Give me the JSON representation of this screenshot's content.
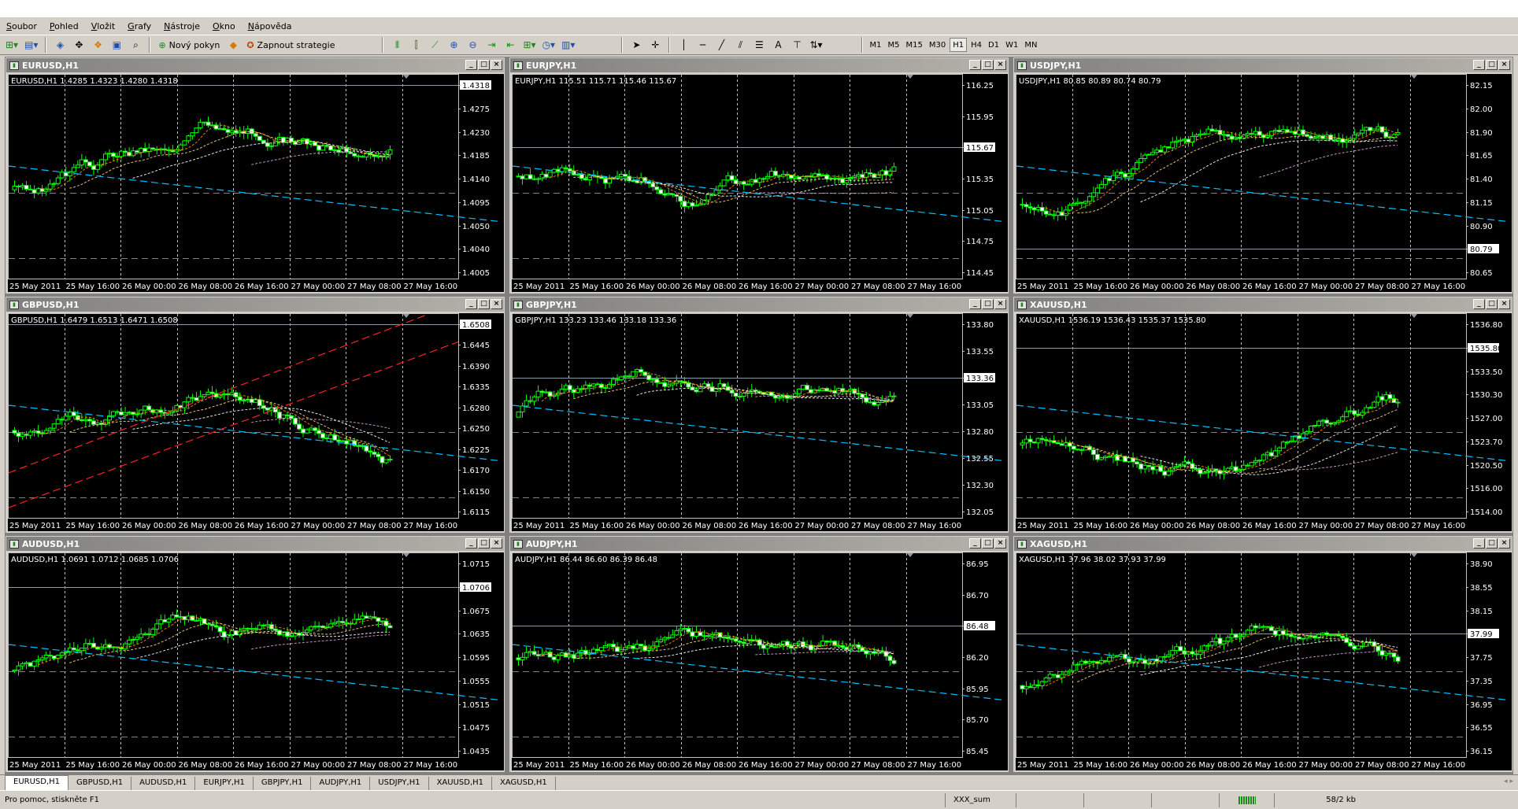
{
  "menu": [
    "Soubor",
    "Pohled",
    "Vložit",
    "Grafy",
    "Nástroje",
    "Okno",
    "Nápověda"
  ],
  "toolbar": {
    "new_order": "Nový pokyn",
    "strategies": "Zapnout strategie",
    "timeframes": [
      "M1",
      "M5",
      "M15",
      "M30",
      "H1",
      "H4",
      "D1",
      "W1",
      "MN"
    ],
    "active_timeframe": "H1"
  },
  "time_labels": [
    "25 May 2011",
    "25 May 16:00",
    "26 May 00:00",
    "26 May 08:00",
    "26 May 16:00",
    "27 May 00:00",
    "27 May 08:00",
    "27 May 16:00"
  ],
  "charts": [
    {
      "title": "EURUSD,H1",
      "ohlc_label": "EURUSD,H1  1.4285 1.4323 1.4280 1.4318",
      "ylabels": [
        "1.4318",
        "1.4275",
        "1.4230",
        "1.4185",
        "1.4140",
        "1.4095",
        "1.4050",
        "1.4040",
        "1.4005"
      ],
      "current": "1.4318"
    },
    {
      "title": "EURJPY,H1",
      "ohlc_label": "EURJPY,H1  115.51 115.71 115.46 115.67",
      "ylabels": [
        "116.25",
        "115.95",
        "115.67",
        "115.35",
        "115.05",
        "114.75",
        "114.45"
      ],
      "current": "115.67"
    },
    {
      "title": "USDJPY,H1",
      "ohlc_label": "USDJPY,H1  80.85 80.89 80.74 80.79",
      "ylabels": [
        "82.15",
        "82.00",
        "81.90",
        "81.65",
        "81.40",
        "81.15",
        "80.90",
        "80.79",
        "80.65"
      ],
      "current": "80.79"
    },
    {
      "title": "GBPUSD,H1",
      "ohlc_label": "GBPUSD,H1  1.6479 1.6513 1.6471 1.6508",
      "ylabels": [
        "1.6508",
        "1.6445",
        "1.6390",
        "1.6335",
        "1.6280",
        "1.6250",
        "1.6225",
        "1.6170",
        "1.6150",
        "1.6115"
      ],
      "current": "1.6508"
    },
    {
      "title": "GBPJPY,H1",
      "ohlc_label": "GBPJPY,H1  133.23 133.46 133.18 133.36",
      "ylabels": [
        "133.80",
        "133.55",
        "133.36",
        "133.05",
        "132.80",
        "132.55",
        "132.30",
        "132.05"
      ],
      "current": "133.36"
    },
    {
      "title": "XAUUSD,H1",
      "ohlc_label": "XAUUSD,H1  1536.19 1536.43 1535.37 1535.80",
      "ylabels": [
        "1536.80",
        "1535.80",
        "1533.50",
        "1530.30",
        "1527.00",
        "1523.70",
        "1520.50",
        "1516.00",
        "1514.00"
      ],
      "current": "1535.80"
    },
    {
      "title": "AUDUSD,H1",
      "ohlc_label": "AUDUSD,H1  1.0691 1.0712 1.0685 1.0706",
      "ylabels": [
        "1.0715",
        "1.0706",
        "1.0675",
        "1.0635",
        "1.0595",
        "1.0555",
        "1.0515",
        "1.0475",
        "1.0435"
      ],
      "current": "1.0706"
    },
    {
      "title": "AUDJPY,H1",
      "ohlc_label": "AUDJPY,H1  86.44 86.60 86.39 86.48",
      "ylabels": [
        "86.95",
        "86.70",
        "86.48",
        "86.20",
        "85.95",
        "85.70",
        "85.45"
      ],
      "current": "86.48"
    },
    {
      "title": "XAGUSD,H1",
      "ohlc_label": "XAGUSD,H1  37.96 38.02 37.93 37.99",
      "ylabels": [
        "38.90",
        "38.55",
        "38.15",
        "37.99",
        "37.75",
        "37.35",
        "36.95",
        "36.55",
        "36.15"
      ],
      "current": "37.99"
    }
  ],
  "tabs": [
    "EURUSD,H1",
    "GBPUSD,H1",
    "AUDUSD,H1",
    "EURJPY,H1",
    "GBPJPY,H1",
    "AUDJPY,H1",
    "USDJPY,H1",
    "XAUUSD,H1",
    "XAGUSD,H1"
  ],
  "active_tab": "EURUSD,H1",
  "status": {
    "help": "Pro pomoc, stiskněte F1",
    "profile": "XXX_sum",
    "traffic": "58/2 kb"
  },
  "colors": {
    "bull": "#00ff00",
    "bear": "#ffffff",
    "grid": "#c0c0c0",
    "trend": "#00bfff",
    "channel": "#ff2020"
  }
}
